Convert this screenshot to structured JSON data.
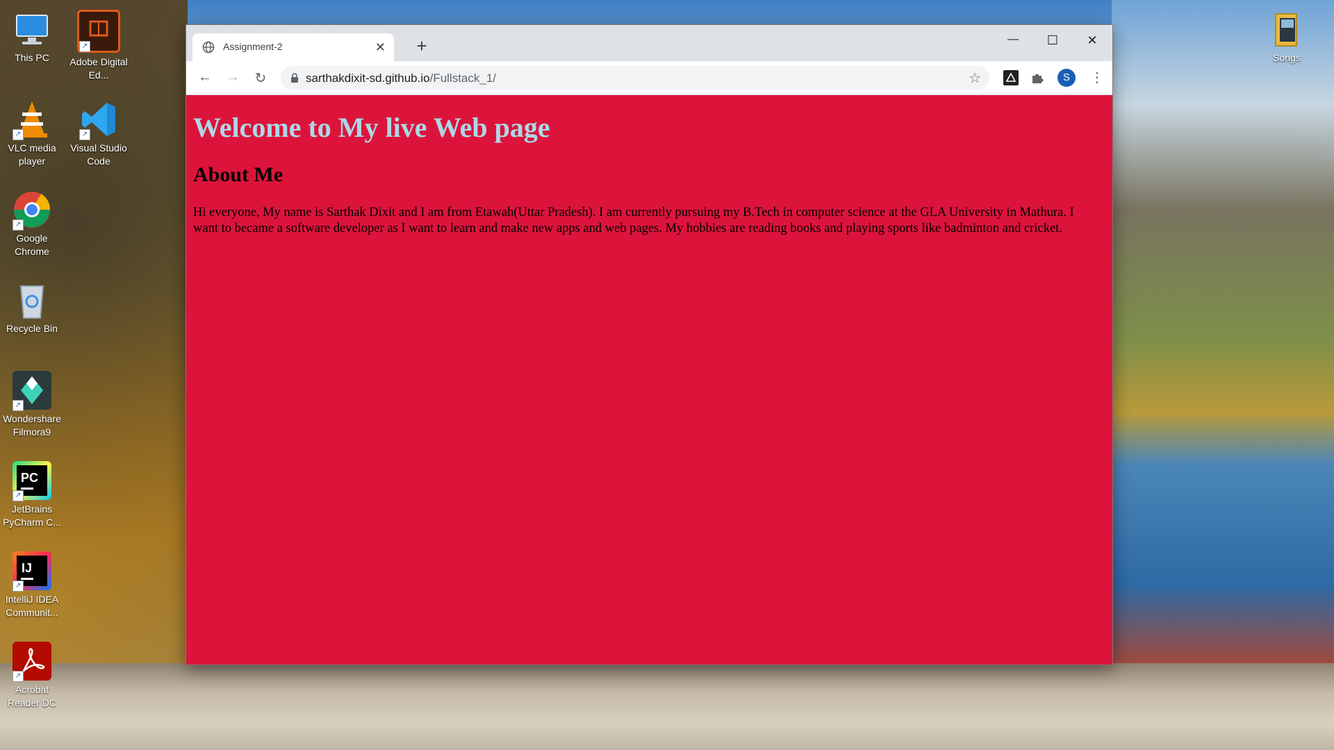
{
  "desktop": {
    "icons_left": [
      {
        "label": "This PC",
        "icon": "computer-icon"
      },
      {
        "label": "Adobe Digital Ed...",
        "icon": "adobe-digital-editions-icon"
      },
      {
        "label": "VLC media player",
        "icon": "vlc-icon"
      },
      {
        "label": "Visual Studio Code",
        "icon": "vscode-icon"
      },
      {
        "label": "Google Chrome",
        "icon": "chrome-icon"
      },
      {
        "label": "Recycle Bin",
        "icon": "recycle-bin-icon"
      },
      {
        "label": "Wondershare Filmora9",
        "icon": "filmora-icon"
      },
      {
        "label": "JetBrains PyCharm C...",
        "icon": "pycharm-icon"
      },
      {
        "label": "IntelliJ IDEA Communit...",
        "icon": "intellij-icon"
      },
      {
        "label": "Acrobat Reader DC",
        "icon": "acrobat-icon"
      }
    ],
    "icons_right": [
      {
        "label": "Songs",
        "icon": "folder-icon"
      }
    ]
  },
  "browser": {
    "tab": {
      "title": "Assignment-2",
      "close": "✕"
    },
    "new_tab": "+",
    "window_controls": {
      "minimize": "—",
      "maximize": "☐",
      "close": "✕"
    },
    "nav": {
      "back": "←",
      "forward": "→",
      "reload": "↻"
    },
    "address": {
      "host": "sarthakdixit-sd.github.io",
      "path": "/Fullstack_1/"
    },
    "star": "☆",
    "profile_initial": "S"
  },
  "page": {
    "heading": "Welcome to My live Web page",
    "subheading": "About Me",
    "paragraph": "Hi everyone, My name is Sarthak Dixit and I am from Etawah(Uttar Pradesh). I am currently pursuing my B.Tech in computer science at the GLA University in Mathura. I want to became a software developer as I want to learn and make new apps and web pages. My hobbies are reading books and playing sports like badminton and cricket."
  },
  "colors": {
    "page_background": "#dc143c",
    "heading_color": "#add8e6"
  }
}
